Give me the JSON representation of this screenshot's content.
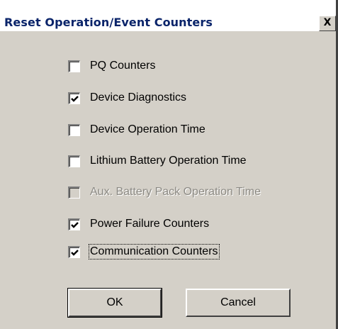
{
  "dialog": {
    "title": "Reset Operation/Event Counters",
    "close_label": "X"
  },
  "options": [
    {
      "label": "PQ Counters",
      "checked": false,
      "disabled": false
    },
    {
      "label": "Device Diagnostics",
      "checked": true,
      "disabled": false
    },
    {
      "label": "Device Operation Time",
      "checked": false,
      "disabled": false
    },
    {
      "label": "Lithium Battery Operation Time",
      "checked": false,
      "disabled": false
    },
    {
      "label": "Aux. Battery Pack Operation Time",
      "checked": false,
      "disabled": true
    },
    {
      "label": "Power Failure Counters",
      "checked": true,
      "disabled": false
    },
    {
      "label": "Communication Counters",
      "checked": true,
      "disabled": false,
      "focused": true
    }
  ],
  "buttons": {
    "ok": "OK",
    "cancel": "Cancel"
  },
  "colors": {
    "title_text": "#0a246a",
    "face": "#d4d0c8",
    "disabled_text": "#8c8a84"
  }
}
